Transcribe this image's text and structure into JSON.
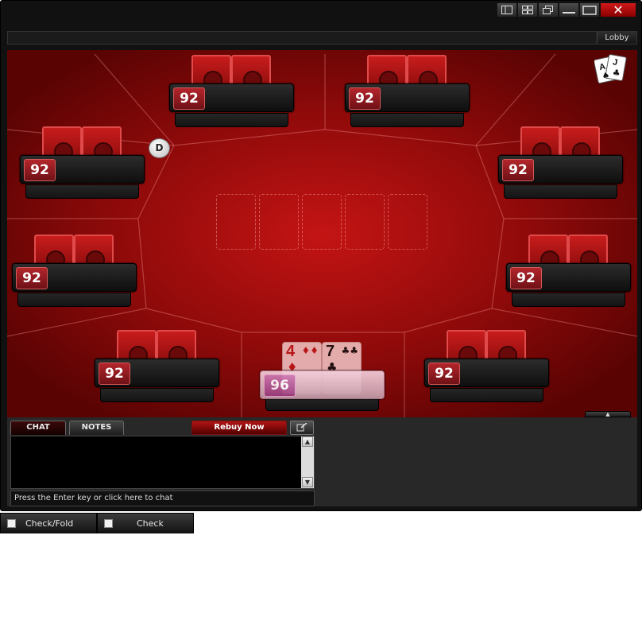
{
  "window": {
    "controls": [
      "layout-icon",
      "grid-icon",
      "restore-icon",
      "minimize-icon",
      "maximize-icon",
      "close-icon"
    ],
    "close_glyph": "✕"
  },
  "infobar": {
    "lobby_label": "Lobby"
  },
  "table": {
    "dealer_label": "D",
    "felt_color": "#b01010",
    "seats": [
      {
        "stack": "92"
      },
      {
        "stack": "92"
      },
      {
        "stack": "92"
      },
      {
        "stack": "92"
      },
      {
        "stack": "92"
      },
      {
        "stack": "92"
      },
      {
        "stack": "92"
      },
      {
        "stack": "92"
      }
    ],
    "hero": {
      "stack": "96",
      "cards": [
        {
          "rank": "4",
          "suit": "♦"
        },
        {
          "rank": "7",
          "suit": "♣"
        }
      ]
    },
    "community_slots": 5
  },
  "chat": {
    "tab_chat": "CHAT",
    "tab_notes": "NOTES",
    "rebuy_label": "Rebuy Now",
    "input_placeholder": "Press the Enter key or click here to chat",
    "scroll_up": "▲",
    "scroll_down": "▼"
  },
  "actions": {
    "check_fold": "Check/Fold",
    "check": "Check"
  },
  "colors": {
    "accent_red": "#c41414",
    "hero_pink": "#cf7bb5"
  }
}
